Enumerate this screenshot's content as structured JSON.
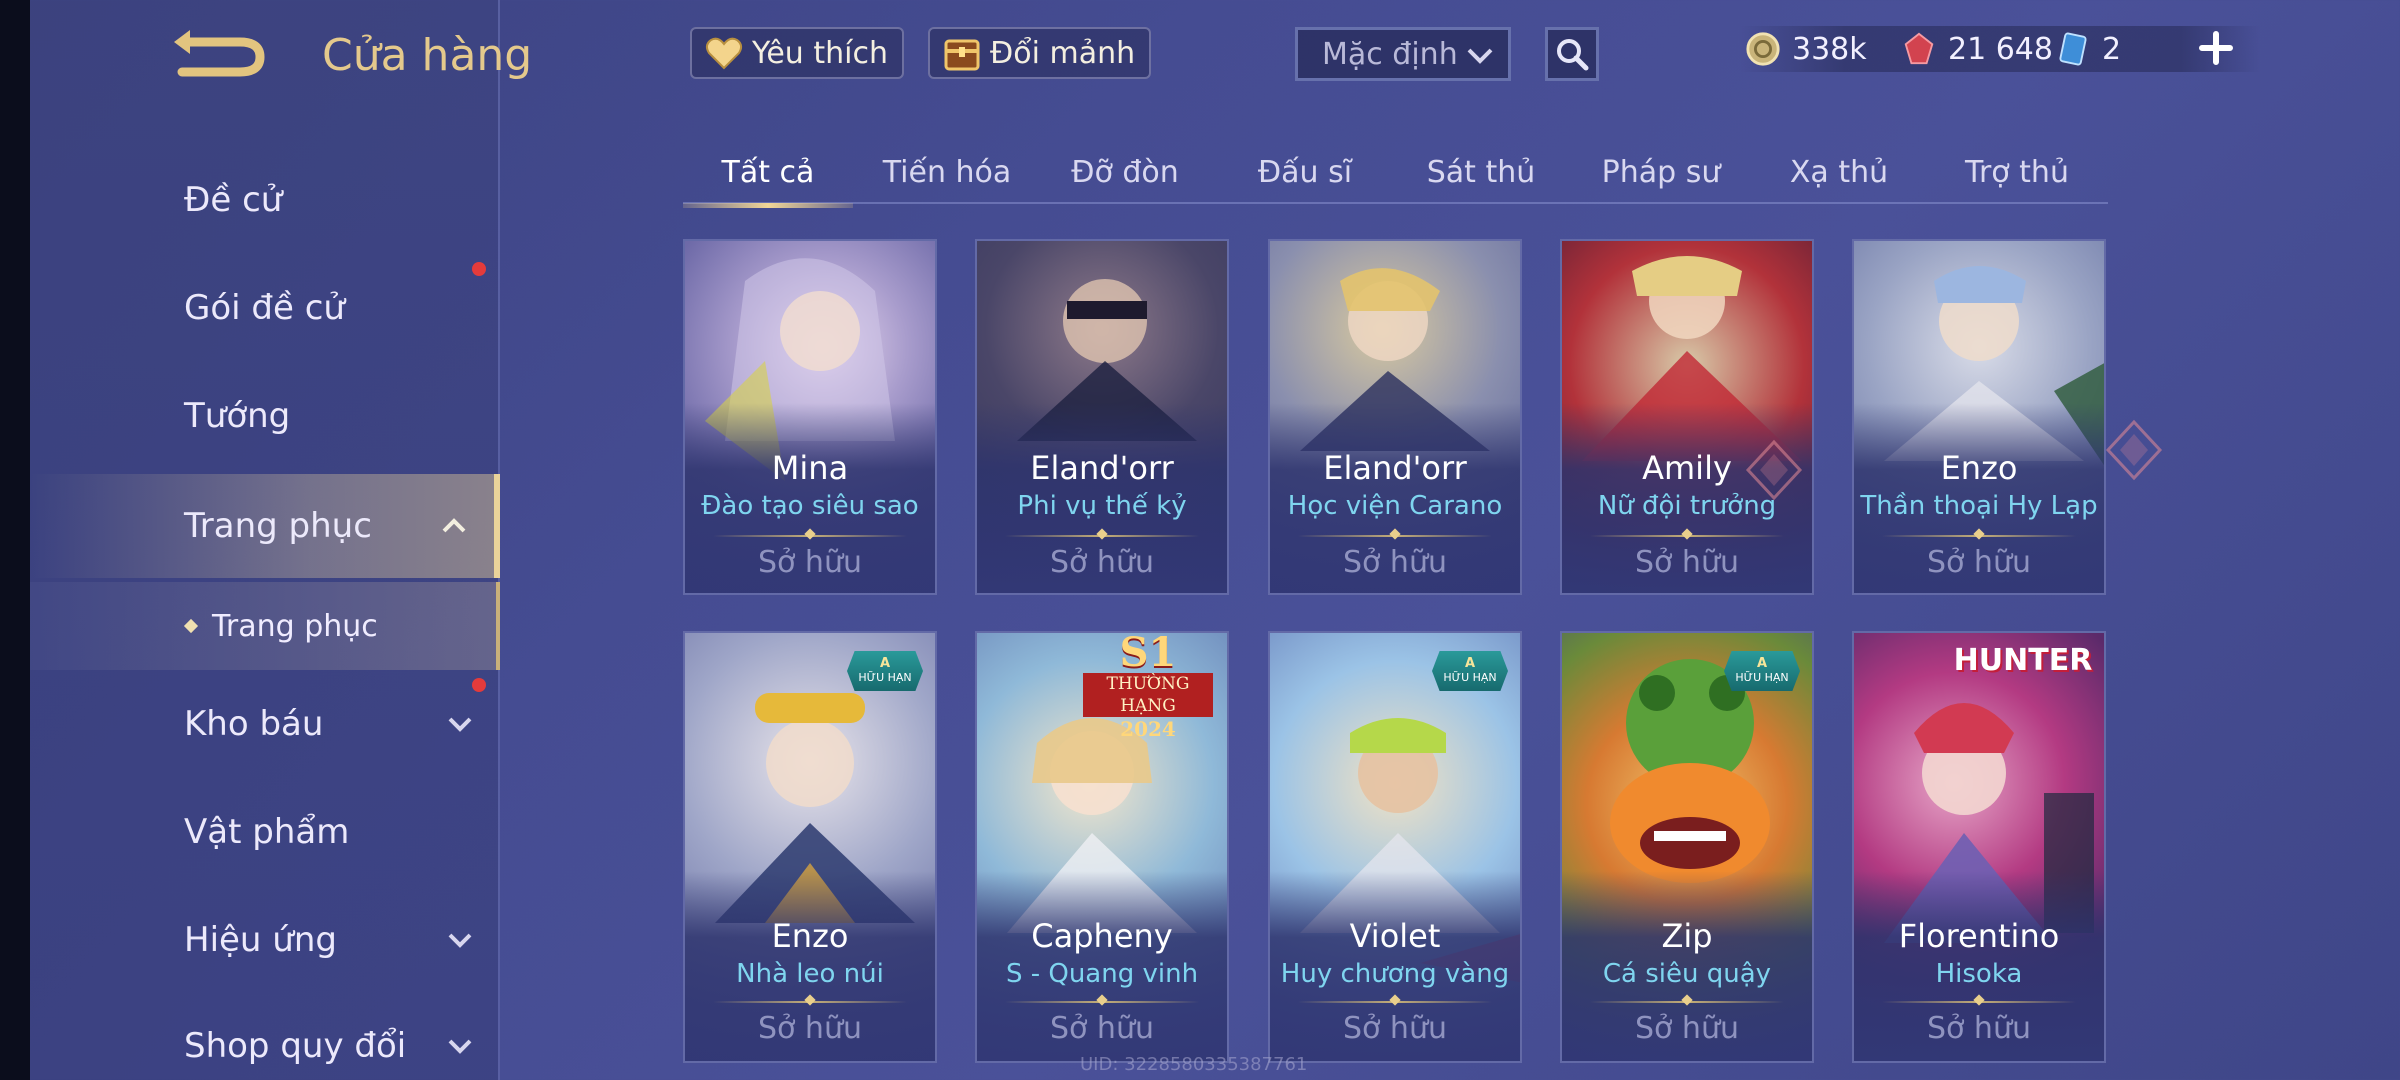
{
  "header": {
    "title": "Cửa hàng",
    "favorite_label": "Yêu thích",
    "exchange_label": "Đổi mảnh",
    "sort_value": "Mặc định"
  },
  "currency": {
    "gold": "338k",
    "vouchers": "21 648",
    "cards": "2"
  },
  "sidebar": {
    "items": [
      {
        "label": "Đề cử"
      },
      {
        "label": "Gói đề cử"
      },
      {
        "label": "Tướng"
      },
      {
        "label": "Trang phục"
      },
      {
        "label": "Kho báu"
      },
      {
        "label": "Vật phẩm"
      },
      {
        "label": "Hiệu ứng"
      },
      {
        "label": "Shop quy đổi"
      }
    ],
    "sub_item": "Trang phục"
  },
  "tabs": [
    "Tất cả",
    "Tiến hóa",
    "Đỡ đòn",
    "Đấu sĩ",
    "Sát thủ",
    "Pháp sư",
    "Xạ thủ",
    "Trợ thủ"
  ],
  "badge": {
    "letter": "A",
    "text": "HỮU HẠN"
  },
  "s1_tag": {
    "big": "S1",
    "mid": "THƯỜNG HẠNG",
    "year": "2024"
  },
  "hunter_tag": "HUNTER",
  "cards": [
    {
      "hero": "Mina",
      "skin": "Đào tạo siêu sao",
      "status": "Sở hữu"
    },
    {
      "hero": "Eland'orr",
      "skin": "Phi vụ thế kỷ",
      "status": "Sở hữu"
    },
    {
      "hero": "Eland'orr",
      "skin": "Học viện Carano",
      "status": "Sở hữu"
    },
    {
      "hero": "Amily",
      "skin": "Nữ đội trưởng",
      "status": "Sở hữu"
    },
    {
      "hero": "Enzo",
      "skin": "Thần thoại Hy Lạp",
      "status": "Sở hữu"
    },
    {
      "hero": "Enzo",
      "skin": "Nhà leo núi",
      "status": "Sở hữu"
    },
    {
      "hero": "Capheny",
      "skin": "S - Quang vinh",
      "status": "Sở hữu"
    },
    {
      "hero": "Violet",
      "skin": "Huy chương vàng",
      "status": "Sở hữu"
    },
    {
      "hero": "Zip",
      "skin": "Cá siêu quậy",
      "status": "Sở hữu"
    },
    {
      "hero": "Florentino",
      "skin": "Hisoka",
      "status": "Sở hữu"
    }
  ],
  "uid": "UID: 3228580335387761",
  "colors": {
    "accent_gold": "#e4c98c",
    "skin_name": "#7fd5ef",
    "notification": "#e43b3b"
  }
}
